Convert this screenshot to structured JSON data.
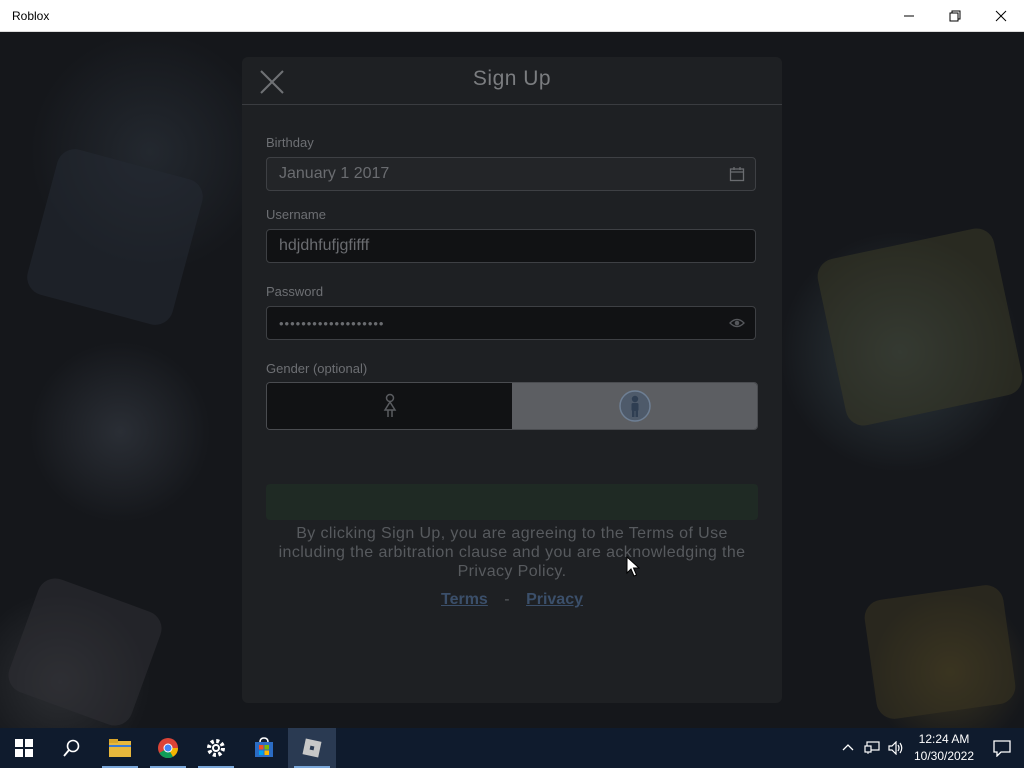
{
  "window": {
    "title": "Roblox"
  },
  "modal": {
    "title": "Sign Up",
    "birthday": {
      "label": "Birthday",
      "value": "January 1 2017"
    },
    "username": {
      "label": "Username",
      "value": "hdjdhfufjgfifff"
    },
    "password": {
      "label": "Password",
      "masked": "•••••••••••••••••••"
    },
    "gender": {
      "label": "Gender (optional)",
      "options": [
        "female",
        "male"
      ],
      "selected": "male"
    },
    "legal_text": "By clicking Sign Up, you are agreeing to the Terms of Use including the arbitration clause and you are acknowledging the Privacy Policy.",
    "links": {
      "terms": "Terms",
      "separator": "-",
      "privacy": "Privacy"
    }
  },
  "taskbar": {
    "apps": [
      "start-icon",
      "search-icon",
      "file-explorer-icon",
      "chrome-icon",
      "settings-icon",
      "microsoft-store-icon",
      "roblox-icon"
    ],
    "active_app": "roblox-icon",
    "time": "12:24 AM",
    "date": "10/30/2022"
  },
  "colors": {
    "taskbar": "#0f1b2d",
    "modal": "#1e2023",
    "link": "#3b4f6a"
  }
}
